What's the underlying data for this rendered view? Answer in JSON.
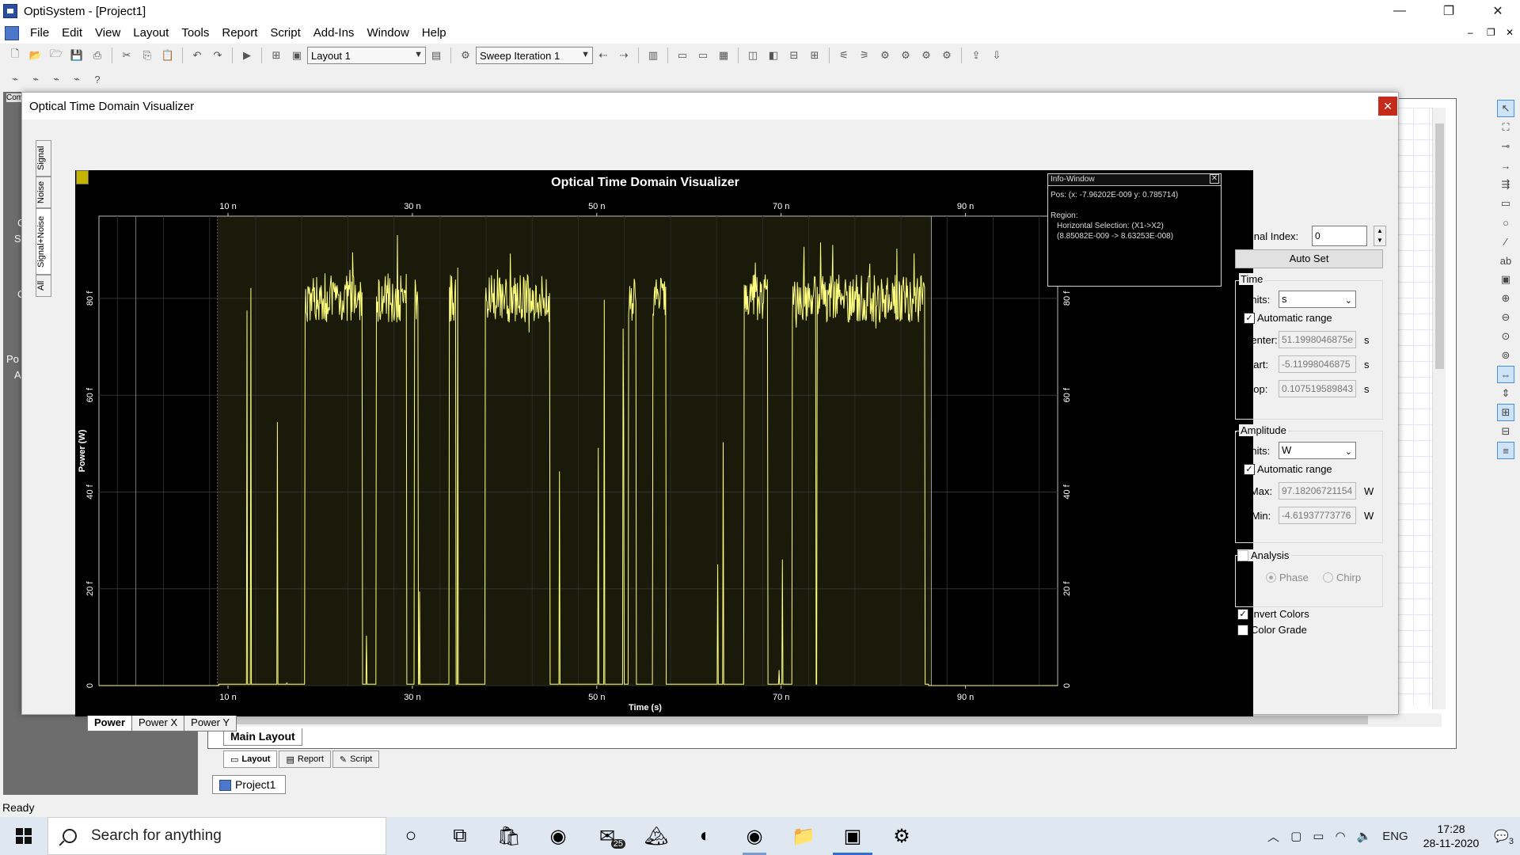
{
  "app": {
    "title": "OptiSystem - [Project1]",
    "window_controls": {
      "minimize": "—",
      "restore": "❐",
      "close": "✕"
    }
  },
  "menu": [
    "File",
    "Edit",
    "View",
    "Layout",
    "Tools",
    "Report",
    "Script",
    "Add-Ins",
    "Window",
    "Help"
  ],
  "toolbar": {
    "layout_combo": "Layout 1",
    "sweep_combo": "Sweep Iteration 1"
  },
  "left_dock_fragments": [
    "Com",
    "C",
    "S",
    "C",
    "Po",
    "A"
  ],
  "visualizer": {
    "window_title": "Optical Time Domain Visualizer",
    "close": "✕",
    "side_tabs": [
      "Signal",
      "Noise",
      "Signal+Noise",
      "All"
    ],
    "bottom_tabs": [
      "Power",
      "Power X",
      "Power Y"
    ],
    "info_window": {
      "title": "Info-Window",
      "pos": "Pos:  (x: -7.96202E-009  y: 0.785714)",
      "region_label": "Region:",
      "region_line1": "Horizontal Selection: (X1->X2)",
      "region_line2": "(8.85082E-009 -> 8.63253E-008)"
    },
    "controls": {
      "signal_index_label": "Signal Index:",
      "signal_index_value": "0",
      "auto_set": "Auto Set",
      "time_group": "Time",
      "time_units_label": "Units:",
      "time_units_value": "s",
      "time_auto_range": "Automatic range",
      "center_label": "Center:",
      "center_value": "51.1998046875e",
      "center_unit": "s",
      "start_label": "Start:",
      "start_value": "-5.11998046875",
      "start_unit": "s",
      "stop_label": "Stop:",
      "stop_value": "0.107519589843",
      "stop_unit": "s",
      "amp_group": "Amplitude",
      "amp_units_label": "Units:",
      "amp_units_value": "W",
      "amp_auto_range": "Automatic range",
      "max_label": "Max:",
      "max_value": "97.18206721154",
      "max_unit": "W",
      "min_label": "Min:",
      "min_value": "-4.61937773776",
      "min_unit": "W",
      "analysis_label": "Analysis",
      "phase_label": "Phase",
      "chirp_label": "Chirp",
      "invert_colors": "Invert Colors",
      "color_grade": "Color Grade"
    }
  },
  "chart_data": {
    "type": "line",
    "title": "Optical Time Domain Visualizer",
    "xlabel": "Time (s)",
    "ylabel": "Power (W)",
    "x_ticks": [
      "10 n",
      "30 n",
      "50 n",
      "70 n",
      "90 n"
    ],
    "x_tick_values": [
      10,
      30,
      50,
      70,
      90
    ],
    "y_ticks": [
      "0",
      "20 f",
      "40 f",
      "60 f",
      "80 f"
    ],
    "y_tick_values": [
      0,
      20,
      40,
      60,
      80
    ],
    "xlim": [
      -4,
      100
    ],
    "ylim": [
      0,
      97
    ],
    "signal_start": 9,
    "signal_end": 86,
    "high_level": 80,
    "high_noise": 10,
    "line_color": "#ffff80",
    "grid": true,
    "selection": [
      8.85,
      86.3
    ]
  },
  "workspace": {
    "main_layout_tab": "Main Layout",
    "bottom_tabs": [
      "Layout",
      "Report",
      "Script"
    ],
    "project_tab": "Project1"
  },
  "status": "Ready",
  "taskbar": {
    "search_placeholder": "Search for anything",
    "mail_badge": "25",
    "lang": "ENG",
    "time": "17:28",
    "date": "28-11-2020",
    "notif_badge": "3"
  }
}
